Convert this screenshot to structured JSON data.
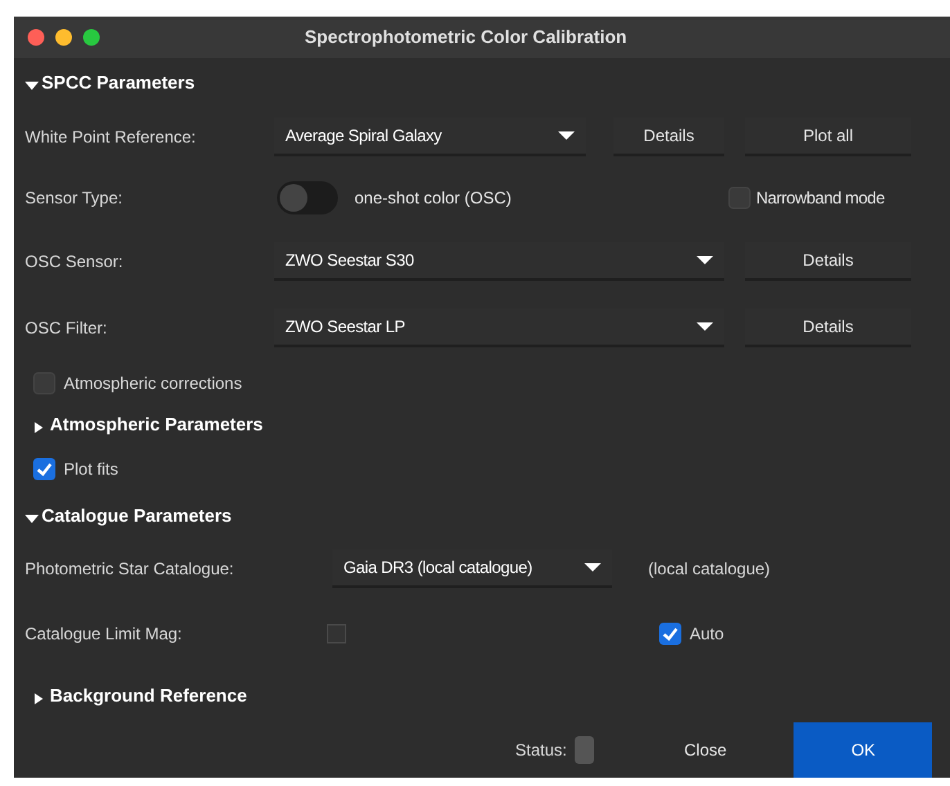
{
  "window": {
    "title": "Spectrophotometric Color Calibration"
  },
  "spcc_parameters": {
    "label": "SPCC Parameters",
    "expanded": true
  },
  "white_point": {
    "label": "White Point Reference:",
    "value": "Average Spiral Galaxy",
    "details_button": "Details",
    "plot_all_button": "Plot all"
  },
  "sensor_type": {
    "label": "Sensor Type:",
    "toggle_on": false,
    "toggle_label": "one-shot color (OSC)",
    "narrowband": {
      "label": "Narrowband mode",
      "checked": false
    }
  },
  "osc_sensor": {
    "label": "OSC Sensor:",
    "value": "ZWO Seestar S30",
    "details_button": "Details"
  },
  "osc_filter": {
    "label": "OSC Filter:",
    "value": "ZWO Seestar LP",
    "details_button": "Details"
  },
  "atmospheric_corrections": {
    "label": "Atmospheric corrections",
    "checked": false
  },
  "atmospheric_parameters": {
    "label": "Atmospheric Parameters",
    "expanded": false
  },
  "plot_fits": {
    "label": "Plot fits",
    "checked": true
  },
  "catalogue_parameters": {
    "label": "Catalogue Parameters",
    "expanded": true
  },
  "star_catalogue": {
    "label": "Photometric Star Catalogue:",
    "value": "Gaia DR3 (local catalogue)",
    "note": "(local catalogue)"
  },
  "limit_mag": {
    "label": "Catalogue Limit Mag:",
    "auto": {
      "label": "Auto",
      "checked": true
    }
  },
  "background_reference": {
    "label": "Background Reference",
    "expanded": false
  },
  "footer": {
    "status_label": "Status:",
    "buttons": [
      "Close",
      "OK"
    ]
  }
}
